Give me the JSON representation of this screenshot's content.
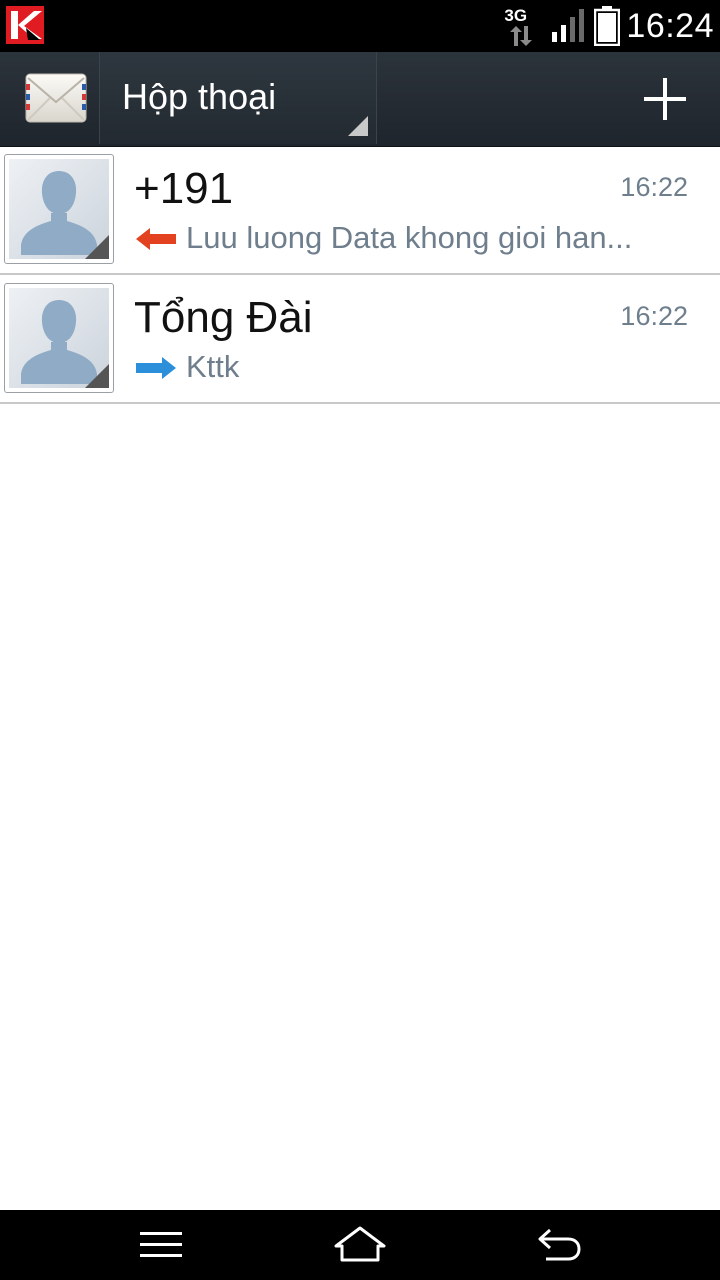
{
  "status_bar": {
    "network_type": "3G",
    "time": "16:24",
    "icons": [
      "kaspersky-icon",
      "data-transfer-icon",
      "signal-icon",
      "battery-icon"
    ]
  },
  "action_bar": {
    "title": "Hộp thoại",
    "icons": [
      "envelope-icon",
      "add-icon"
    ]
  },
  "conversations": [
    {
      "name": "+191",
      "time": "16:22",
      "direction": "incoming",
      "snippet": "Luu luong Data khong gioi han..."
    },
    {
      "name": "Tổng Đài",
      "time": "16:22",
      "direction": "outgoing",
      "snippet": "Kttk"
    }
  ],
  "colors": {
    "incoming_arrow": "#e2421f",
    "outgoing_arrow": "#2b8fd9",
    "snippet": "#6e7e8c",
    "avatar": "#8fabc6"
  },
  "nav_bar": {
    "icons": [
      "menu-icon",
      "home-icon",
      "back-icon"
    ]
  }
}
